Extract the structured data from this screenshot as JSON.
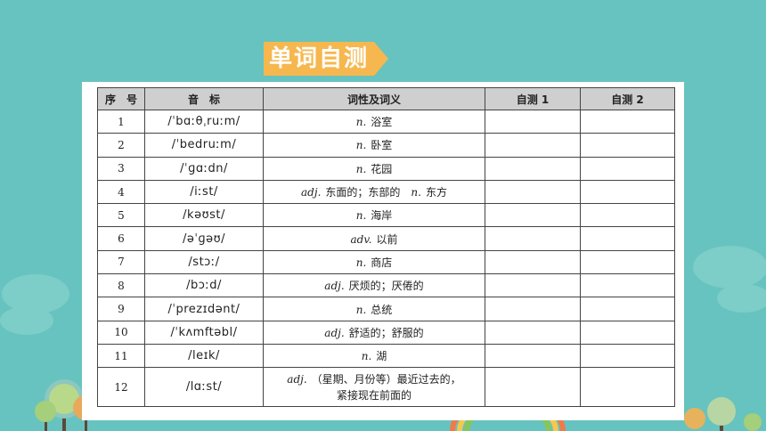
{
  "title": "单词自测",
  "colors": {
    "background": "#67c3bf",
    "title_tag": "#f6b74e",
    "header_bg": "#cfcfcf"
  },
  "table": {
    "headers": [
      "序　号",
      "音　标",
      "词性及词义",
      "自测 1",
      "自测 2"
    ],
    "rows": [
      {
        "no": "1",
        "ipa": "/ˈbɑːθˌruːm/",
        "pos": "n.",
        "meaning": "浴室"
      },
      {
        "no": "2",
        "ipa": "/ˈbedruːm/",
        "pos": "n.",
        "meaning": "卧室"
      },
      {
        "no": "3",
        "ipa": "/ˈɡɑːdn/",
        "pos": "n.",
        "meaning": "花园"
      },
      {
        "no": "4",
        "ipa": "/iːst/",
        "pos": "adj.",
        "meaning": "东面的；东部的",
        "pos2": "n.",
        "meaning2": "东方"
      },
      {
        "no": "5",
        "ipa": "/kəʊst/",
        "pos": "n.",
        "meaning": "海岸"
      },
      {
        "no": "6",
        "ipa": "/əˈɡəʊ/",
        "pos": "adv.",
        "meaning": "以前"
      },
      {
        "no": "7",
        "ipa": "/stɔː/",
        "pos": "n.",
        "meaning": "商店"
      },
      {
        "no": "8",
        "ipa": "/bɔːd/",
        "pos": "adj.",
        "meaning": "厌烦的；厌倦的"
      },
      {
        "no": "9",
        "ipa": "/ˈprezɪdənt/",
        "pos": "n.",
        "meaning": "总统"
      },
      {
        "no": "10",
        "ipa": "/ˈkʌmftəbl/",
        "pos": "adj.",
        "meaning": "舒适的；舒服的"
      },
      {
        "no": "11",
        "ipa": "/leɪk/",
        "pos": "n.",
        "meaning": "湖"
      },
      {
        "no": "12",
        "ipa": "/lɑːst/",
        "pos": "adj.",
        "meaning": "（星期、月份等）最近过去的，",
        "meaning_line2": "紧接现在前面的"
      }
    ]
  }
}
